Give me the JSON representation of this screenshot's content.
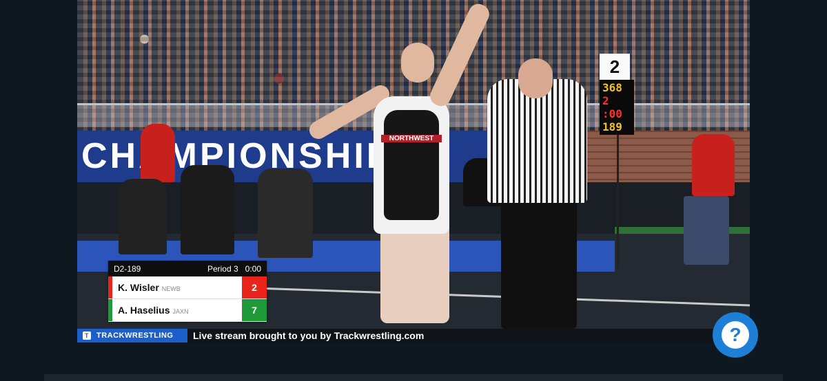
{
  "video": {
    "banner_text": "CHAMPIONSHIPS",
    "singlet_text": "NORTHWEST",
    "tower": {
      "mat_number": "2",
      "digits": [
        "368",
        "2 :00",
        "189"
      ]
    }
  },
  "scoreboard": {
    "weight_class": "D2-189",
    "period": "Period 3",
    "clock": "0:00",
    "wrestlers": [
      {
        "name": "K. Wisler",
        "team": "NEWB",
        "score": "2",
        "color": "#e8241b"
      },
      {
        "name": "A. Haselius",
        "team": "JAXN",
        "score": "7",
        "color": "#1e9a3a"
      }
    ]
  },
  "ticker": {
    "logo_text": "TRACKWRESTLING",
    "message": "Live stream brought to you by Trackwrestling.com"
  },
  "help_button": {
    "icon": "question-icon",
    "glyph": "?"
  },
  "colors": {
    "background": "#0d1820",
    "accent": "#1d7fd6",
    "banner": "#1f3b8c"
  }
}
